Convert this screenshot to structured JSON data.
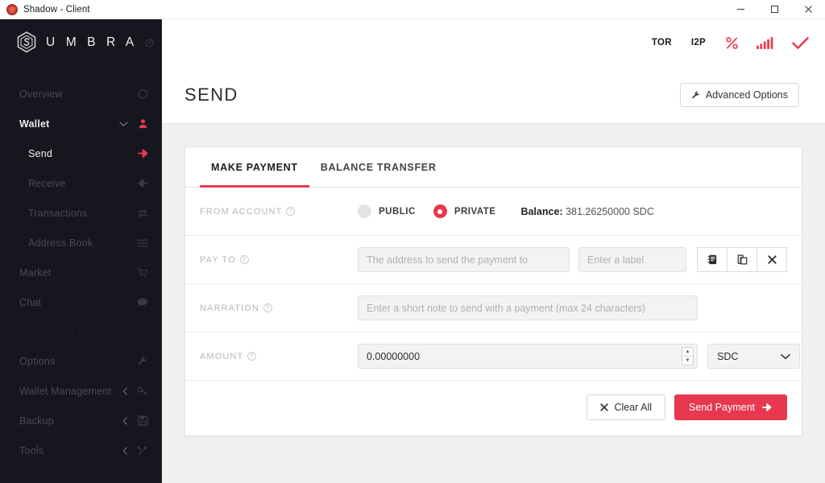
{
  "window": {
    "title": "Shadow - Client",
    "app_icon": "shadow-logo-icon",
    "minimize": "–",
    "maximize": "□",
    "close": "✕"
  },
  "sidebar": {
    "brand": "U M B R A",
    "brand_mark_icon": "umbra-hex-logo-icon",
    "clock_icon": "clock-icon",
    "items": [
      {
        "label": "Overview",
        "icon": "circle-icon",
        "state": "inactive",
        "level": "top",
        "caret": ""
      },
      {
        "label": "Wallet",
        "icon": "user-icon",
        "state": "active",
        "level": "top",
        "caret": "⌄"
      },
      {
        "label": "Send",
        "icon": "arrow-right-icon",
        "state": "active",
        "level": "sub",
        "caret": ""
      },
      {
        "label": "Receive",
        "icon": "arrow-left-icon",
        "state": "inactive",
        "level": "sub",
        "caret": ""
      },
      {
        "label": "Transactions",
        "icon": "exchange-icon",
        "state": "inactive",
        "level": "sub",
        "caret": ""
      },
      {
        "label": "Address Book",
        "icon": "list-icon",
        "state": "inactive",
        "level": "sub",
        "caret": ""
      },
      {
        "label": "Market",
        "icon": "cart-icon",
        "state": "inactive",
        "level": "top",
        "caret": ""
      },
      {
        "label": "Chat",
        "icon": "comment-icon",
        "state": "inactive",
        "level": "top",
        "caret": ""
      }
    ],
    "section_label": "PREFERENCES",
    "items_lower": [
      {
        "label": "Options",
        "icon": "wrench-icon",
        "state": "inactive",
        "level": "top",
        "caret": ""
      },
      {
        "label": "Wallet Management",
        "icon": "key-icon",
        "state": "inactive",
        "level": "top",
        "caret": "‹"
      },
      {
        "label": "Backup",
        "icon": "save-icon",
        "state": "inactive",
        "level": "top",
        "caret": "‹"
      },
      {
        "label": "Tools",
        "icon": "tools-icon",
        "state": "inactive",
        "level": "top",
        "caret": "‹"
      }
    ]
  },
  "topbar": {
    "tor_label": "TOR",
    "i2p_label": "I2P",
    "percent_icon": "percent-icon",
    "signal_icon": "signal-bars-icon",
    "check_icon": "check-icon"
  },
  "page": {
    "title": "SEND",
    "advanced_label": "Advanced Options",
    "advanced_icon": "wrench-icon"
  },
  "tabs": [
    {
      "label": "MAKE PAYMENT",
      "active": true
    },
    {
      "label": "BALANCE TRANSFER",
      "active": false
    }
  ],
  "form": {
    "from_account": {
      "label": "FROM ACCOUNT",
      "help_icon": "help-icon",
      "options": [
        {
          "label": "PUBLIC",
          "selected": false
        },
        {
          "label": "PRIVATE",
          "selected": true
        }
      ],
      "balance_label": "Balance:",
      "balance_value": "381.26250000 SDC"
    },
    "pay_to": {
      "label": "PAY TO",
      "help_icon": "help-icon",
      "address_value": "",
      "address_placeholder": "The address to send the payment to",
      "label_value": "",
      "label_placeholder": "Enter a label",
      "buttons": [
        {
          "icon": "address-book-icon"
        },
        {
          "icon": "paste-icon"
        },
        {
          "icon": "clear-x-icon"
        }
      ]
    },
    "narration": {
      "label": "NARRATION",
      "help_icon": "help-icon",
      "value": "",
      "placeholder": "Enter a short note to send with a payment (max 24 characters)"
    },
    "amount": {
      "label": "AMOUNT",
      "help_icon": "help-icon",
      "value": "0.00000000",
      "spin_up": "▲",
      "spin_down": "▼",
      "currency": "SDC",
      "currency_chevron": "⌄"
    }
  },
  "actions": {
    "clear_icon": "x-icon",
    "clear_label": "Clear All",
    "send_label": "Send Payment",
    "send_icon": "arrow-right-icon"
  },
  "colors": {
    "accent": "#e8384f",
    "sidebar_bg": "#16161f",
    "page_bg": "#f0f0f0"
  }
}
